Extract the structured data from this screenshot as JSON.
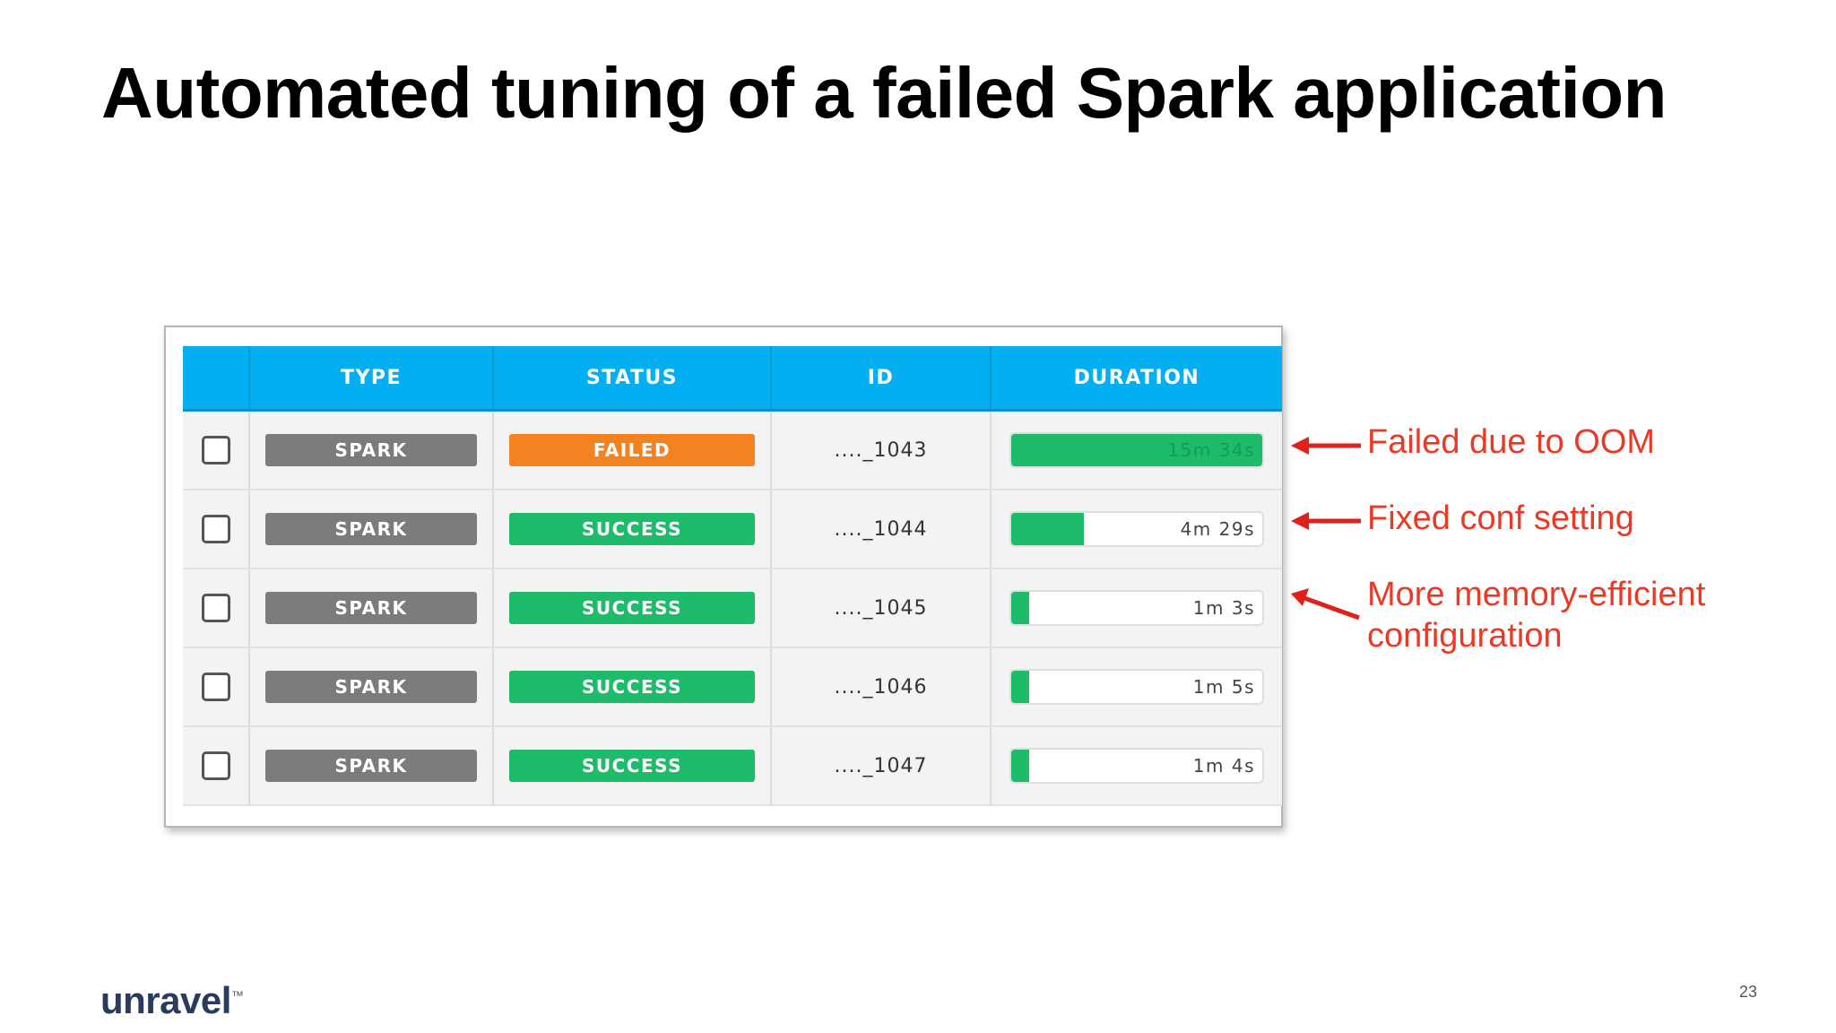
{
  "slide": {
    "title": "Automated tuning of a failed Spark application",
    "page_number": "23",
    "logo_text": "unravel",
    "logo_mark": "™"
  },
  "table": {
    "headers": [
      "TYPE",
      "STATUS",
      "ID",
      "DURATION"
    ],
    "rows": [
      {
        "type": "SPARK",
        "status": "FAILED",
        "status_color": "#f58220",
        "id": "...._1043",
        "duration": "15m 34s",
        "duration_fraction": 1.0
      },
      {
        "type": "SPARK",
        "status": "SUCCESS",
        "status_color": "#1dbb6a",
        "id": "...._1044",
        "duration": "4m 29s",
        "duration_fraction": 0.29
      },
      {
        "type": "SPARK",
        "status": "SUCCESS",
        "status_color": "#1dbb6a",
        "id": "...._1045",
        "duration": "1m 3s",
        "duration_fraction": 0.07
      },
      {
        "type": "SPARK",
        "status": "SUCCESS",
        "status_color": "#1dbb6a",
        "id": "...._1046",
        "duration": "1m 5s",
        "duration_fraction": 0.07
      },
      {
        "type": "SPARK",
        "status": "SUCCESS",
        "status_color": "#1dbb6a",
        "id": "...._1047",
        "duration": "1m 4s",
        "duration_fraction": 0.07
      }
    ]
  },
  "annotations": {
    "items": [
      {
        "lines": [
          "Failed due to OOM"
        ]
      },
      {
        "lines": [
          "Fixed conf setting"
        ]
      },
      {
        "lines": [
          "More memory-efficient",
          "configuration"
        ]
      }
    ],
    "color": "#ea3a26"
  },
  "colors": {
    "header_blue": "#03aff0",
    "type_gray": "#7c7c7c",
    "success_green": "#1dbb6a",
    "failed_orange": "#f58220"
  }
}
